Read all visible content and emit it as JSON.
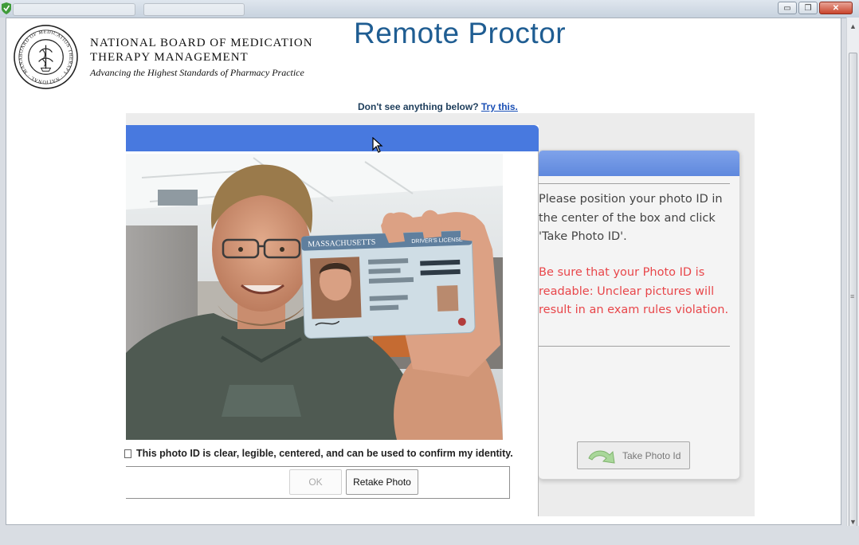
{
  "header": {
    "org_line1": "NATIONAL BOARD OF MEDICATION",
    "org_line2": "THERAPY MANAGEMENT",
    "org_tagline": "Advancing the Highest Standards of Pharmacy Practice",
    "seal_text": "BOARD OF MEDICATION THERAPY · NATIONAL · MANAGEMENT"
  },
  "app_title": "Remote Proctor",
  "help": {
    "text": "Don't see anything below?",
    "link": "Try this."
  },
  "instructions": {
    "position_text": "Please position your photo ID in the center of the box and click 'Take Photo ID'.",
    "warning_text": "Be sure that your Photo ID is readable: Unclear pictures will result in an exam rules violation.",
    "take_photo_label": "Take Photo Id"
  },
  "capture": {
    "confirm_label": "This photo ID is clear, legible, centered, and can be used to confirm my identity.",
    "confirm_checked": false,
    "ok_label": "OK",
    "retake_label": "Retake Photo"
  },
  "id_card": {
    "state": "MASSACHUSETTS",
    "type": "DRIVER'S LICENSE"
  },
  "colors": {
    "title_blue": "#1f5d92",
    "dialog_header": "#4879df",
    "warning_red": "#e8464a",
    "link_blue": "#1a4fb5"
  },
  "window_controls": {
    "minimize": "▭",
    "restore": "❐",
    "close": "✕"
  }
}
